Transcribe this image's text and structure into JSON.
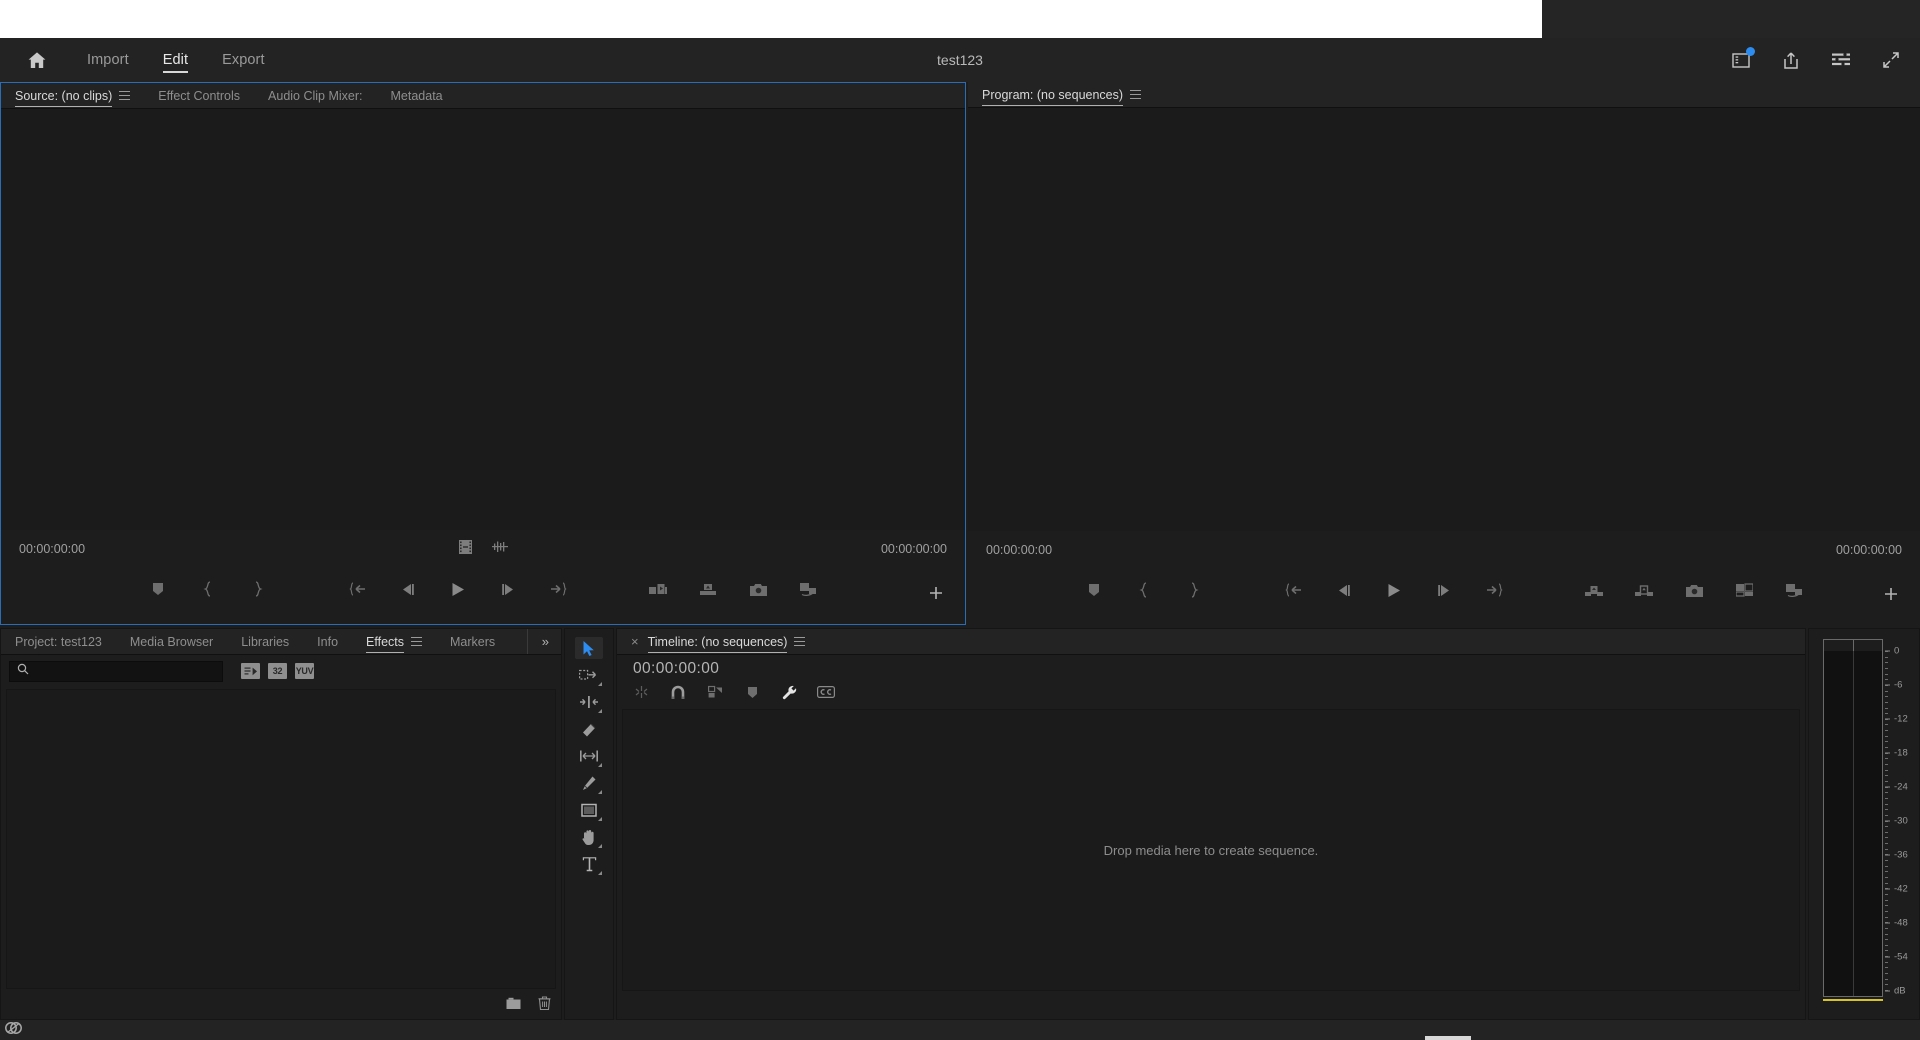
{
  "app": {
    "title": "test123",
    "accent_color": "#2b6cb9",
    "panel_bg": "#1d1d1d",
    "header_bg": "#232323"
  },
  "header": {
    "home_icon": "home-icon",
    "tabs": [
      {
        "label": "Import",
        "active": false
      },
      {
        "label": "Edit",
        "active": true
      },
      {
        "label": "Export",
        "active": false
      }
    ],
    "title": "test123",
    "icons": [
      {
        "name": "workspaces-icon",
        "badge": true
      },
      {
        "name": "share-icon",
        "badge": false
      },
      {
        "name": "quick-export-menu-icon",
        "badge": false
      },
      {
        "name": "fullscreen-icon",
        "badge": false
      }
    ]
  },
  "source_monitor": {
    "tabs": [
      {
        "label": "Source: (no clips)",
        "active": true,
        "menu": true
      },
      {
        "label": "Effect Controls",
        "active": false,
        "menu": false
      },
      {
        "label": "Audio Clip Mixer:",
        "active": false,
        "menu": false
      },
      {
        "label": "Metadata",
        "active": false,
        "menu": false
      }
    ],
    "timecode_left": "00:00:00:00",
    "timecode_right": "00:00:00:00",
    "center_icons": [
      "film-strip-icon",
      "audio-waveform-icon"
    ],
    "controls": [
      "add-marker-icon",
      "mark-in-icon",
      "mark-out-icon",
      "go-to-in-icon",
      "step-back-icon",
      "play-icon",
      "step-forward-icon",
      "go-to-out-icon",
      "insert-icon",
      "overwrite-icon",
      "export-frame-icon",
      "comparison-view-icon"
    ],
    "plus_label": "+"
  },
  "program_monitor": {
    "tabs": [
      {
        "label": "Program: (no sequences)",
        "active": true,
        "menu": true
      }
    ],
    "timecode_left": "00:00:00:00",
    "timecode_right": "00:00:00:00",
    "controls": [
      "add-marker-icon",
      "mark-in-icon",
      "mark-out-icon",
      "go-to-in-icon",
      "step-back-icon",
      "play-icon",
      "step-forward-icon",
      "go-to-out-icon",
      "lift-icon",
      "extract-icon",
      "export-frame-icon",
      "comparison-view-icon",
      "multicam-icon"
    ],
    "plus_label": "+"
  },
  "project_panel": {
    "tabs": [
      {
        "label": "Project: test123",
        "active": false,
        "menu": false
      },
      {
        "label": "Media Browser",
        "active": false,
        "menu": false
      },
      {
        "label": "Libraries",
        "active": false,
        "menu": false
      },
      {
        "label": "Info",
        "active": false,
        "menu": false
      },
      {
        "label": "Effects",
        "active": true,
        "menu": true
      },
      {
        "label": "Markers",
        "active": false,
        "menu": false
      }
    ],
    "overflow_label": "»",
    "search": {
      "value": "",
      "placeholder": ""
    },
    "filter_badges": [
      {
        "name": "accelerated-effects-badge",
        "label": ""
      },
      {
        "name": "32-bit-color-badge",
        "label": "32"
      },
      {
        "name": "yuv-effects-badge",
        "label": "YUV"
      }
    ],
    "footer_icons": [
      "new-custom-bin-icon",
      "delete-icon"
    ]
  },
  "tools_panel": {
    "tools": [
      {
        "name": "selection-tool",
        "active": true,
        "has_flyout": false
      },
      {
        "name": "track-select-forward-tool",
        "active": false,
        "has_flyout": true
      },
      {
        "name": "ripple-edit-tool",
        "active": false,
        "has_flyout": true
      },
      {
        "name": "razor-tool",
        "active": false,
        "has_flyout": false
      },
      {
        "name": "rate-stretch-tool",
        "active": false,
        "has_flyout": true
      },
      {
        "name": "pen-tool",
        "active": false,
        "has_flyout": true
      },
      {
        "name": "rectangle-tool",
        "active": false,
        "has_flyout": true
      },
      {
        "name": "hand-tool",
        "active": false,
        "has_flyout": true
      },
      {
        "name": "type-tool",
        "active": false,
        "has_flyout": true
      }
    ]
  },
  "timeline_panel": {
    "tab": {
      "label": "Timeline: (no sequences)",
      "close": "×",
      "menu": true
    },
    "timecode": "00:00:00:00",
    "tools": [
      {
        "name": "insert-overwrite-icon",
        "active": false
      },
      {
        "name": "snap-icon",
        "active": false
      },
      {
        "name": "linked-selection-icon",
        "active": false
      },
      {
        "name": "add-marker-icon",
        "active": false
      },
      {
        "name": "timeline-settings-wrench-icon",
        "active": true
      },
      {
        "name": "captions-cc-icon",
        "active": false
      }
    ],
    "drop_message": "Drop media here to create sequence."
  },
  "audio_meter": {
    "unit_label": "dB",
    "scale": [
      "0",
      "-6",
      "-12",
      "-18",
      "-24",
      "-30",
      "-36",
      "-42",
      "-48",
      "-54"
    ],
    "channels": 2,
    "level_color": "#d8c326"
  },
  "status_bar": {
    "icon": "creative-cloud-icon"
  }
}
